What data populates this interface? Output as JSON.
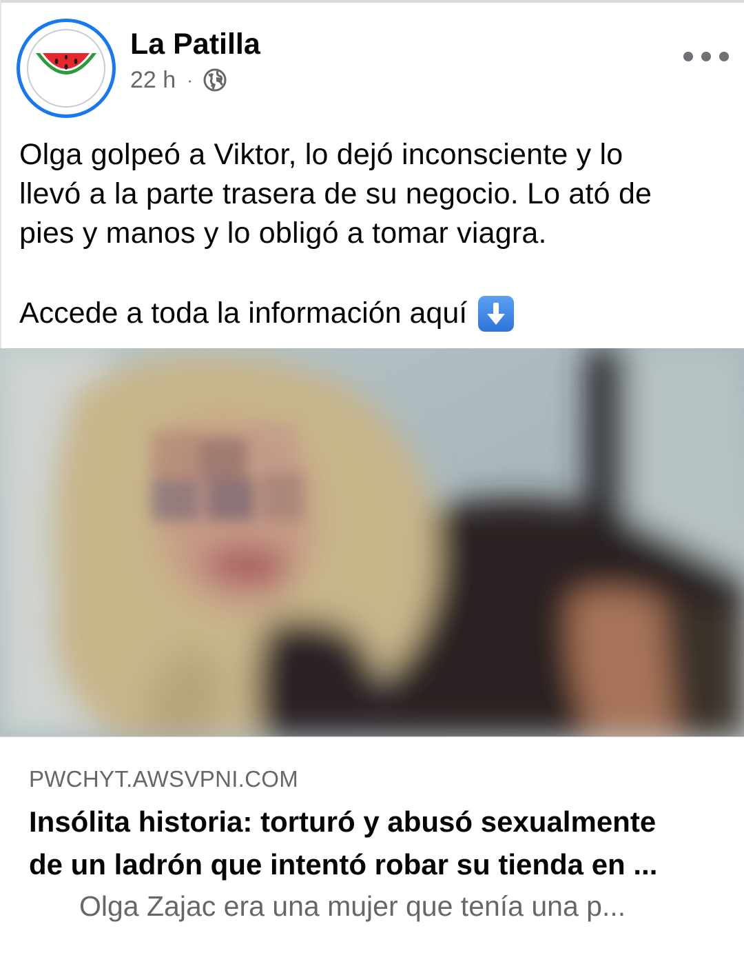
{
  "post": {
    "author": "La Patilla",
    "time": "22 h",
    "separator": "·",
    "audience_icon": "globe-icon",
    "menu_icon": "more-horizontal-icon",
    "text_line1": "Olga golpeó a Viktor, lo dejó inconsciente y lo",
    "text_line2": "llevó a la parte trasera de su negocio. Lo ató de",
    "text_line3": "pies y manos y lo obligó a tomar viagra.",
    "cta": "Accede a toda la información aquí",
    "cta_emoji": "down-arrow-emoji"
  },
  "link": {
    "domain": "PWCHYT.AWSVPNI.COM",
    "title_line1": "Insólita historia: torturó y abusó sexualmente",
    "title_line2": "de un ladrón que intentó robar su tienda en ...",
    "description": "Olga Zajac era una mujer que tenía una p..."
  },
  "colors": {
    "accent": "#1877f2",
    "text_primary": "#050505",
    "text_secondary": "#65676b",
    "watermelon_red": "#e8262d",
    "watermelon_green": "#2e9a3c"
  }
}
